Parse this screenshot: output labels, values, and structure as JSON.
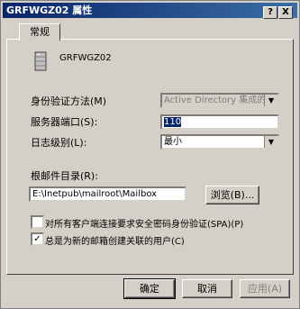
{
  "window": {
    "title": "GRFWGZ02 属性",
    "help_label": "?",
    "close_label": "X"
  },
  "tabs": [
    {
      "label": "常规"
    }
  ],
  "server": {
    "name": "GRFWGZ02",
    "icon": "server-icon"
  },
  "auth": {
    "label": "身份验证方法(M)",
    "value": "Active Directory 集成的"
  },
  "port": {
    "label": "服务器端口(S):",
    "value": "110"
  },
  "log": {
    "label": "日志级别(L):",
    "value": "最小"
  },
  "mailroot": {
    "label": "根邮件目录(R):",
    "value": "E:\\Inetpub\\mailroot\\Mailbox",
    "browse_label": "浏览(B)..."
  },
  "options": [
    {
      "label": "对所有客户端连接要求安全密码身份验证(SPA)(P)",
      "checked": false
    },
    {
      "label": "总是为新的邮箱创建关联的用户(C)",
      "checked": true
    }
  ],
  "buttons": {
    "ok": "确定",
    "cancel": "取消",
    "apply": "应用(A)"
  },
  "colors": {
    "titlebar": "#0a246a",
    "face": "#d4d0c8"
  }
}
